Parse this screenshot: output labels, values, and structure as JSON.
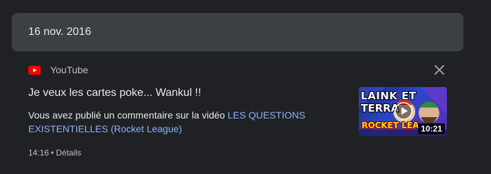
{
  "date_header": {
    "label": "16 nov. 2016"
  },
  "activity": {
    "source": {
      "name": "YouTube",
      "icon": "youtube-logo-icon"
    },
    "title": "Je veux les cartes poke... Wankul !!",
    "description": {
      "prefix": "Vous avez publié un commentaire sur la vidéo ",
      "link_text": "LES QUESTIONS EXISTENTIELLES (Rocket League)"
    },
    "meta": {
      "time": "14:16",
      "separator": "•",
      "details_label": "Détails"
    },
    "thumbnail": {
      "overlay_line1": "LAINK ET",
      "overlay_line2": "TERRA",
      "overlay_line3": "ROCKET LEA",
      "duration": "10:21"
    },
    "close_icon": "close-icon"
  },
  "colors": {
    "background": "#202124",
    "header_background": "#3c4043",
    "link": "#8ab4f8",
    "secondary_text": "#bdc1c6",
    "youtube_red": "#ff0000"
  }
}
